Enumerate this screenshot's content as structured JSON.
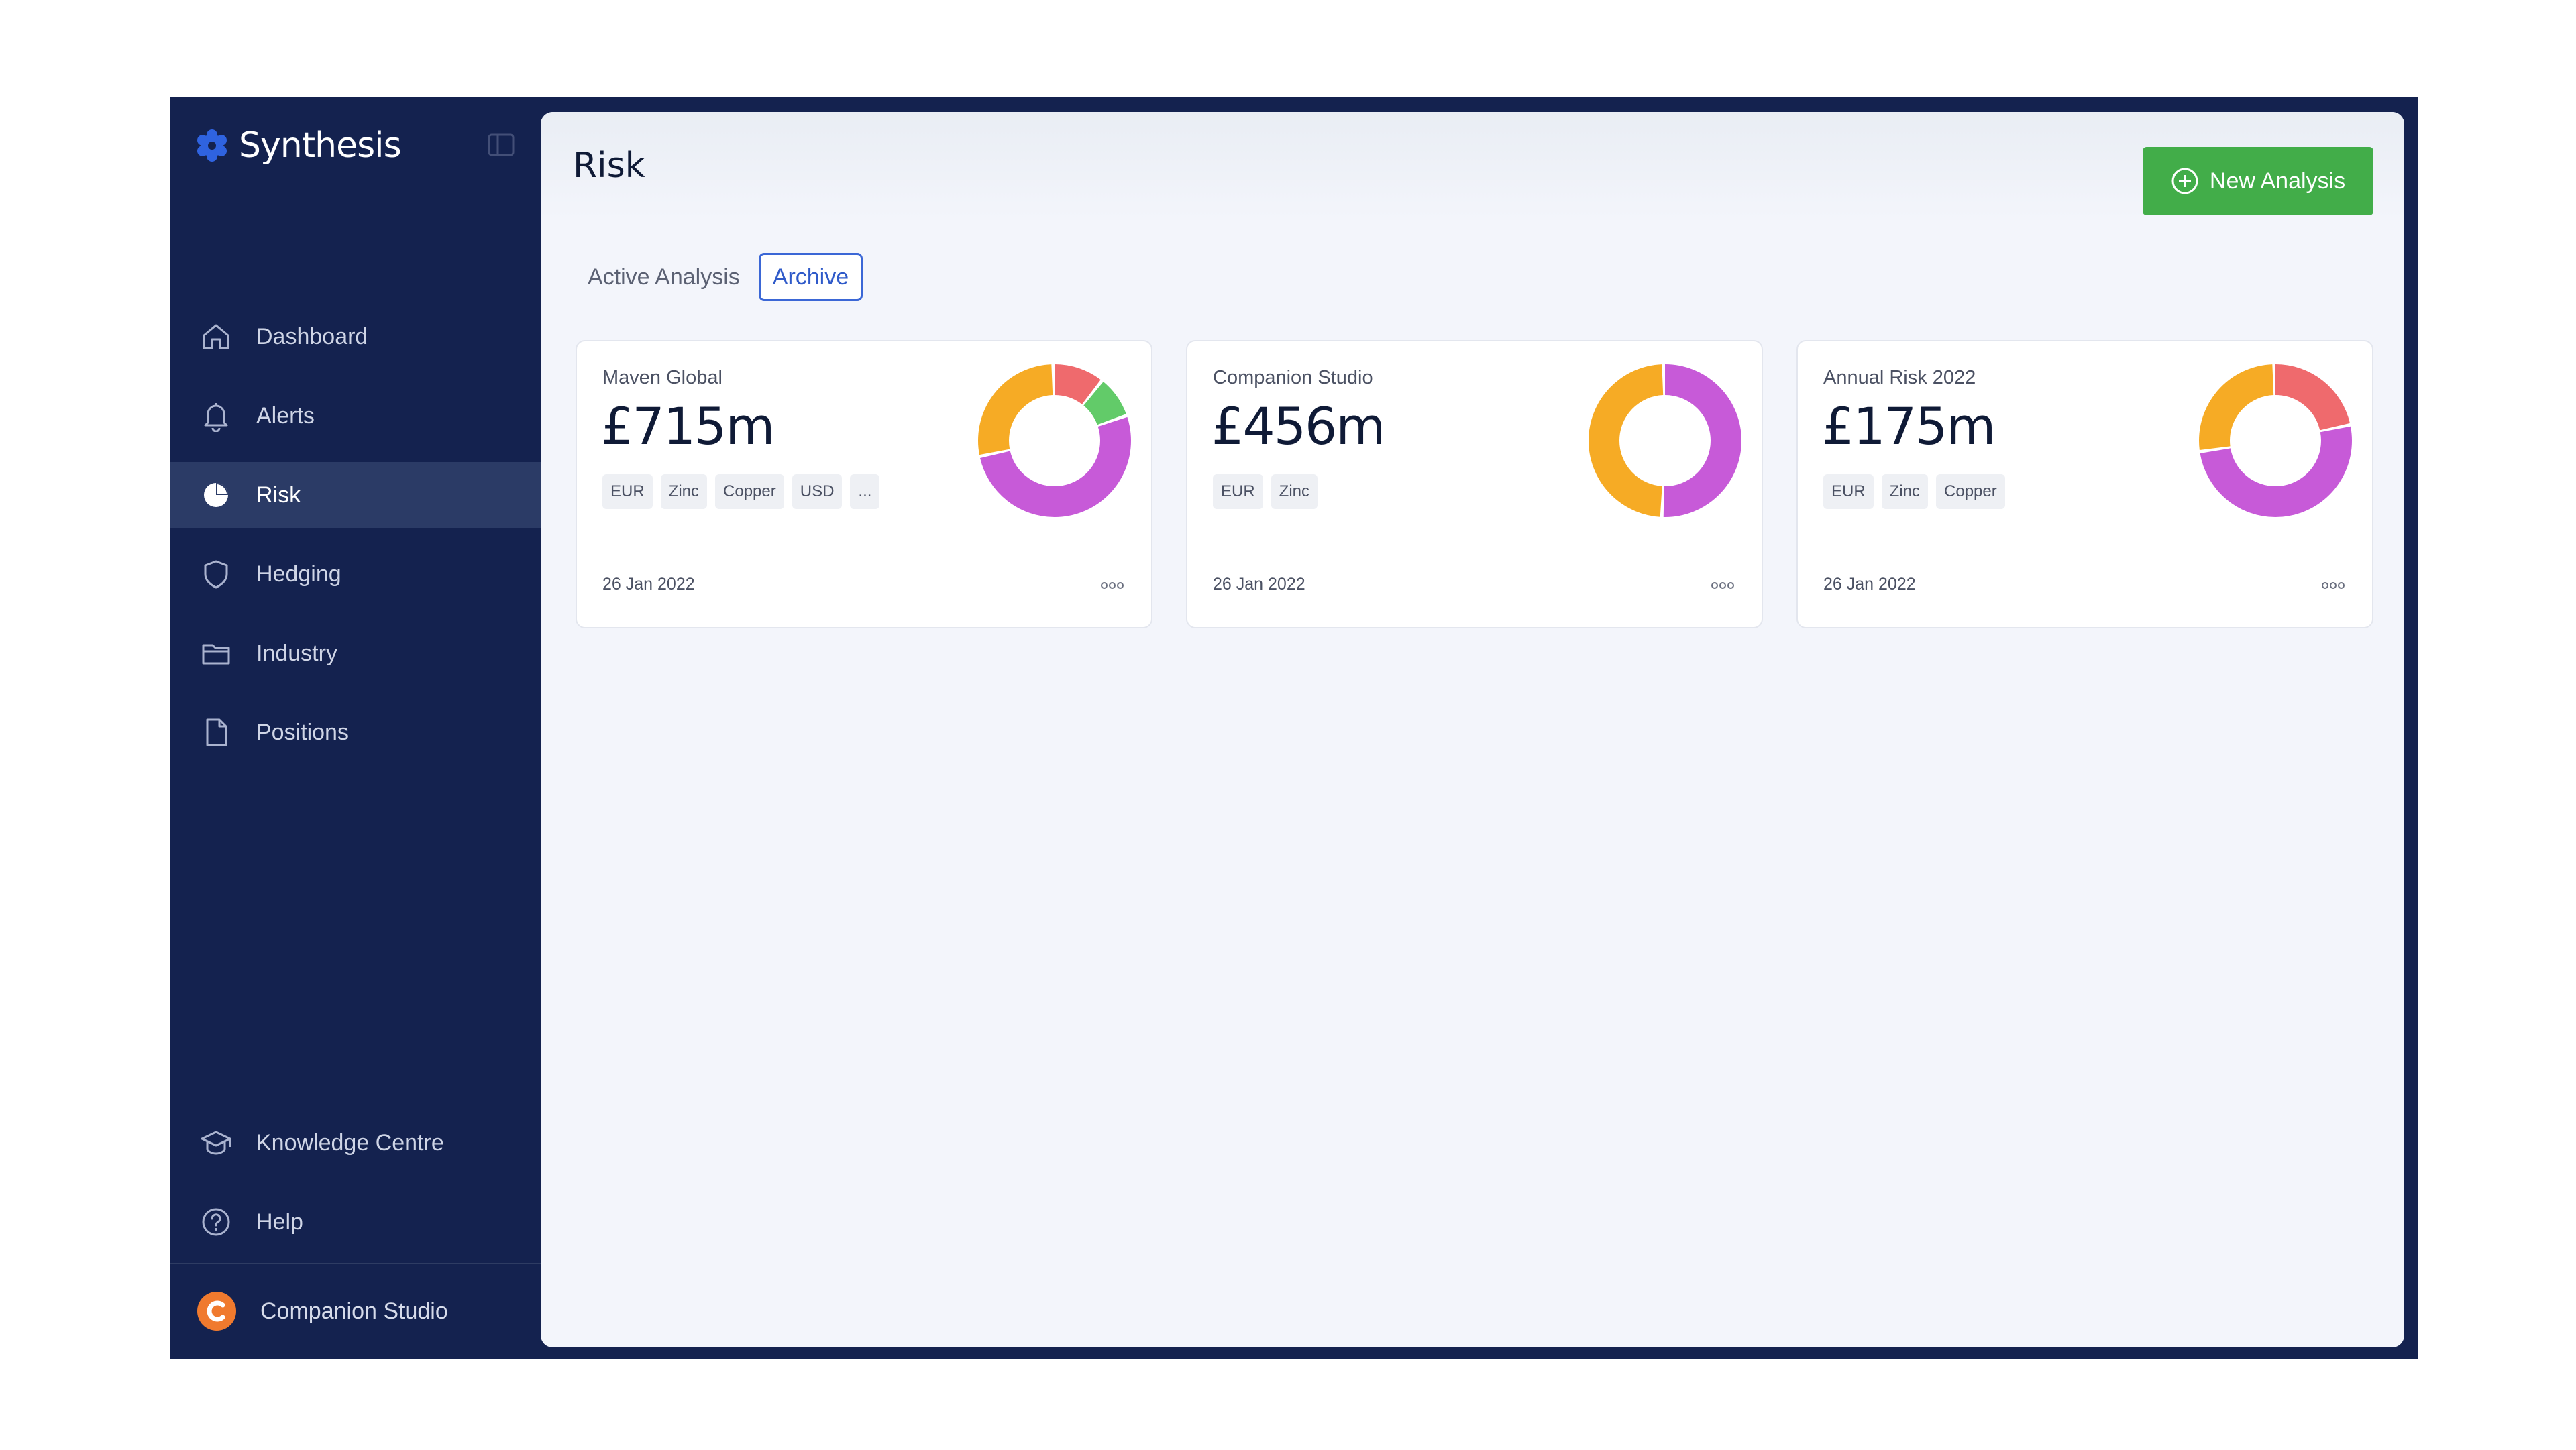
{
  "app": {
    "name": "Synthesis",
    "brand_color": "#2f63e0"
  },
  "sidebar": {
    "items": [
      {
        "label": "Dashboard",
        "icon": "home-icon",
        "active": false
      },
      {
        "label": "Alerts",
        "icon": "bell-icon",
        "active": false
      },
      {
        "label": "Risk",
        "icon": "pie-chart-icon",
        "active": true
      },
      {
        "label": "Hedging",
        "icon": "shield-icon",
        "active": false
      },
      {
        "label": "Industry",
        "icon": "folder-icon",
        "active": false
      },
      {
        "label": "Positions",
        "icon": "document-icon",
        "active": false
      }
    ],
    "bottom_items": [
      {
        "label": "Knowledge Centre",
        "icon": "graduation-cap-icon"
      },
      {
        "label": "Help",
        "icon": "help-circle-icon"
      }
    ],
    "account": {
      "label": "Companion Studio",
      "avatar_color": "#f07a2e"
    }
  },
  "main": {
    "title": "Risk",
    "new_button_label": "New Analysis",
    "new_button_color": "#42ad49",
    "tabs": [
      {
        "label": "Active Analysis",
        "active": false
      },
      {
        "label": "Archive",
        "active": true
      }
    ]
  },
  "cards": [
    {
      "name": "Maven Global",
      "amount": "£715m",
      "tags": [
        "EUR",
        "Zinc",
        "Copper",
        "USD",
        "..."
      ],
      "date": "26 Jan 2022",
      "breakdown": [
        {
          "color": "#f6ab25",
          "fraction": 0.28
        },
        {
          "color": "#c75ad8",
          "fraction": 0.52
        },
        {
          "color": "#62cb69",
          "fraction": 0.09
        },
        {
          "color": "#ef6a6d",
          "fraction": 0.11
        }
      ]
    },
    {
      "name": "Companion Studio",
      "amount": "£456m",
      "tags": [
        "EUR",
        "Zinc"
      ],
      "date": "26 Jan 2022",
      "breakdown": [
        {
          "color": "#f6ab25",
          "fraction": 0.49
        },
        {
          "color": "#c75ad8",
          "fraction": 0.51
        }
      ]
    },
    {
      "name": "Annual Risk 2022",
      "amount": "£175m",
      "tags": [
        "EUR",
        "Zinc",
        "Copper"
      ],
      "date": "26 Jan 2022",
      "breakdown": [
        {
          "color": "#f6ab25",
          "fraction": 0.27
        },
        {
          "color": "#c75ad8",
          "fraction": 0.51
        },
        {
          "color": "#ef6a6d",
          "fraction": 0.22
        }
      ]
    }
  ]
}
